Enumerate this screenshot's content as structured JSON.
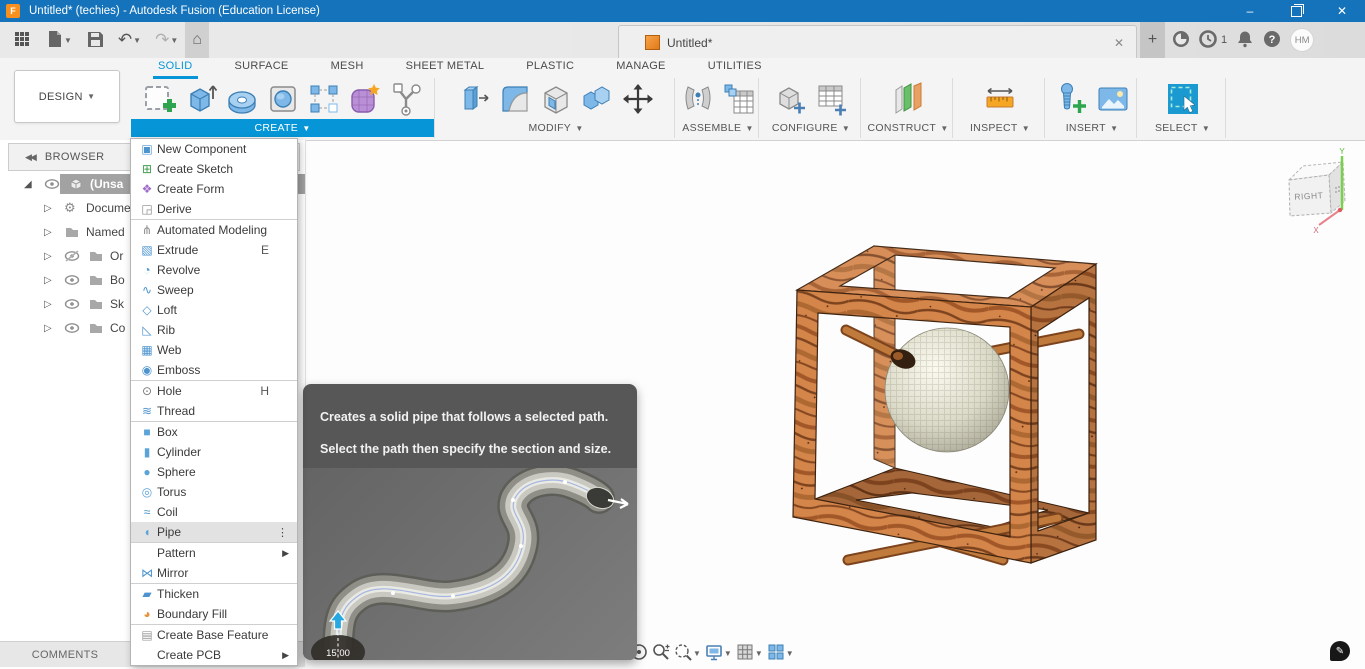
{
  "window": {
    "title": "Untitled* (techies) - Autodesk Fusion (Education License)",
    "logo_letter": "F",
    "controls": {
      "minimize": "–",
      "restore": "restore",
      "close": "✕"
    }
  },
  "qat": {
    "items": [
      {
        "name": "app-grid",
        "caret": false
      },
      {
        "name": "file-new",
        "caret": true
      },
      {
        "name": "save",
        "caret": false
      },
      {
        "name": "undo",
        "caret": true
      },
      {
        "name": "redo",
        "caret": true
      },
      {
        "name": "home",
        "caret": false,
        "active": true
      }
    ]
  },
  "tabbar": {
    "active_tab": {
      "label": "Untitled*",
      "close_glyph": "✕"
    },
    "new_tab_glyph": "+",
    "job_count": "1",
    "avatar_initials": "HM"
  },
  "ribbon": {
    "tabs": [
      {
        "label": "SOLID",
        "active": true
      },
      {
        "label": "SURFACE",
        "active": false
      },
      {
        "label": "MESH",
        "active": false
      },
      {
        "label": "SHEET METAL",
        "active": false
      },
      {
        "label": "PLASTIC",
        "active": false
      },
      {
        "label": "MANAGE",
        "active": false
      },
      {
        "label": "UTILITIES",
        "active": false
      }
    ],
    "groups": [
      {
        "label": "CREATE",
        "open": true,
        "tools": [
          "create-sketch",
          "extrude",
          "revolve",
          "hole",
          "pattern",
          "create-form",
          "automated-modeling"
        ]
      },
      {
        "label": "MODIFY",
        "open": false,
        "tools": [
          "press-pull",
          "fillet",
          "shell",
          "combine",
          "move"
        ]
      },
      {
        "label": "ASSEMBLE",
        "open": false,
        "tools": [
          "joint",
          "component-table"
        ]
      },
      {
        "label": "CONFIGURE",
        "open": false,
        "tools": [
          "configuration",
          "configuration-table"
        ]
      },
      {
        "label": "CONSTRUCT",
        "open": false,
        "tools": [
          "construction-plane"
        ]
      },
      {
        "label": "INSPECT",
        "open": false,
        "tools": [
          "measure"
        ]
      },
      {
        "label": "INSERT",
        "open": false,
        "tools": [
          "insert-fastener",
          "canvas"
        ]
      },
      {
        "label": "SELECT",
        "open": false,
        "tools": [
          "select"
        ]
      }
    ]
  },
  "design_selector": {
    "label": "DESIGN"
  },
  "browser": {
    "header": "BROWSER",
    "rows": [
      {
        "label": "(Unsa",
        "icon": "component-cube",
        "eye": "visible",
        "expander": "expanded",
        "selected": true,
        "indent": 0
      },
      {
        "label": "Docume",
        "icon": "gear",
        "eye": "none",
        "expander": "collapsed",
        "selected": false,
        "indent": 0
      },
      {
        "label": "Named ",
        "icon": "folder",
        "eye": "none",
        "expander": "collapsed",
        "selected": false,
        "indent": 0
      },
      {
        "label": "Or",
        "icon": "folder",
        "eye": "hidden",
        "expander": "collapsed",
        "selected": false,
        "indent": 1
      },
      {
        "label": "Bo",
        "icon": "folder",
        "eye": "visible",
        "expander": "collapsed",
        "selected": false,
        "indent": 1
      },
      {
        "label": "Sk",
        "icon": "folder",
        "eye": "visible",
        "expander": "collapsed",
        "selected": false,
        "indent": 1
      },
      {
        "label": "Co",
        "icon": "folder",
        "eye": "visible",
        "expander": "collapsed",
        "selected": false,
        "indent": 1
      }
    ]
  },
  "create_menu": {
    "items": [
      {
        "label": "New Component",
        "icon": "new-component"
      },
      {
        "label": "Create Sketch",
        "icon": "create-sketch"
      },
      {
        "label": "Create Form",
        "icon": "create-form"
      },
      {
        "label": "Derive",
        "icon": "derive",
        "divider_after": true
      },
      {
        "label": "Automated Modeling",
        "icon": "automated-modeling"
      },
      {
        "label": "Extrude",
        "icon": "extrude",
        "shortcut": "E"
      },
      {
        "label": "Revolve",
        "icon": "revolve"
      },
      {
        "label": "Sweep",
        "icon": "sweep"
      },
      {
        "label": "Loft",
        "icon": "loft"
      },
      {
        "label": "Rib",
        "icon": "rib"
      },
      {
        "label": "Web",
        "icon": "web"
      },
      {
        "label": "Emboss",
        "icon": "emboss",
        "divider_after": true
      },
      {
        "label": "Hole",
        "icon": "hole",
        "shortcut": "H"
      },
      {
        "label": "Thread",
        "icon": "thread",
        "divider_after": true
      },
      {
        "label": "Box",
        "icon": "box"
      },
      {
        "label": "Cylinder",
        "icon": "cylinder"
      },
      {
        "label": "Sphere",
        "icon": "sphere"
      },
      {
        "label": "Torus",
        "icon": "torus"
      },
      {
        "label": "Coil",
        "icon": "coil"
      },
      {
        "label": "Pipe",
        "icon": "pipe",
        "highlighted": true,
        "kebab": true,
        "divider_after": true
      },
      {
        "label": "Pattern",
        "submenu": true
      },
      {
        "label": "Mirror",
        "icon": "mirror",
        "divider_after": true
      },
      {
        "label": "Thicken",
        "icon": "thicken"
      },
      {
        "label": "Boundary Fill",
        "icon": "boundary-fill",
        "divider_after": true
      },
      {
        "label": "Create Base Feature",
        "icon": "create-base-feature"
      },
      {
        "label": "Create PCB",
        "submenu": true
      }
    ]
  },
  "tooltip": {
    "line1": "Creates a solid pipe that follows a selected path.",
    "line2": "Select the path then specify the section and size.",
    "dimension": "15.00"
  },
  "viewcube": {
    "face_label": "RIGHT",
    "axis_x": "X",
    "axis_y": "Y"
  },
  "navbar": {
    "tools": [
      "orbit",
      "zoom",
      "zoom-window",
      "display-settings",
      "grid-display",
      "viewports"
    ]
  },
  "comments": {
    "label": "COMMENTS"
  },
  "colors": {
    "titlebar": "#1473bb",
    "accent": "#0696d7",
    "wood": "#d4854a",
    "sphere": "#d9d7c6"
  }
}
